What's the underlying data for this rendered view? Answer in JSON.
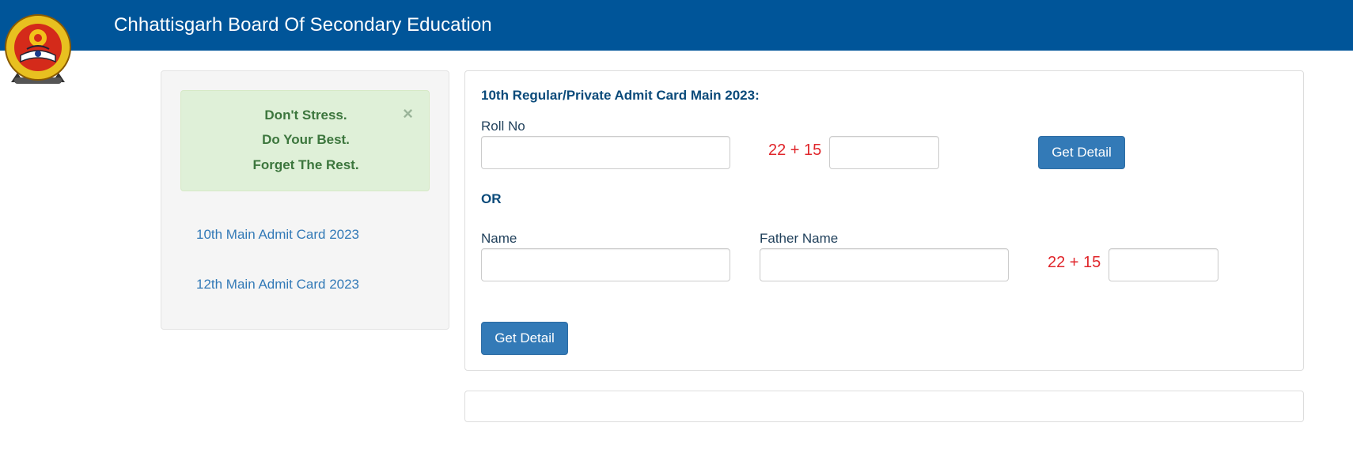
{
  "header": {
    "title": "Chhattisgarh Board Of Secondary Education",
    "logo_icon": "cgbse-emblem-logo"
  },
  "sidebar": {
    "alert": {
      "line1": "Don't Stress.",
      "line2": "Do Your Best.",
      "line3": "Forget The Rest.",
      "close": "×"
    },
    "links": [
      {
        "label": "10th Main Admit Card 2023"
      },
      {
        "label": "12th Main Admit Card 2023"
      }
    ]
  },
  "main": {
    "title": "10th Regular/Private Admit Card Main 2023:",
    "roll_section": {
      "roll_label": "Roll No",
      "roll_value": "",
      "captcha": "22 + 15",
      "captcha_value": "",
      "button": "Get Detail"
    },
    "or_label": "OR",
    "name_section": {
      "name_label": "Name",
      "name_value": "",
      "father_label": "Father Name",
      "father_value": "",
      "captcha": "22 + 15",
      "captcha_value": "",
      "button": "Get Detail"
    }
  },
  "colors": {
    "header_bg": "#005599",
    "button": "#337ab7",
    "captcha": "#e0262b",
    "alert_bg": "#dff0d8",
    "alert_text": "#3c763d",
    "link": "#337ab7"
  }
}
